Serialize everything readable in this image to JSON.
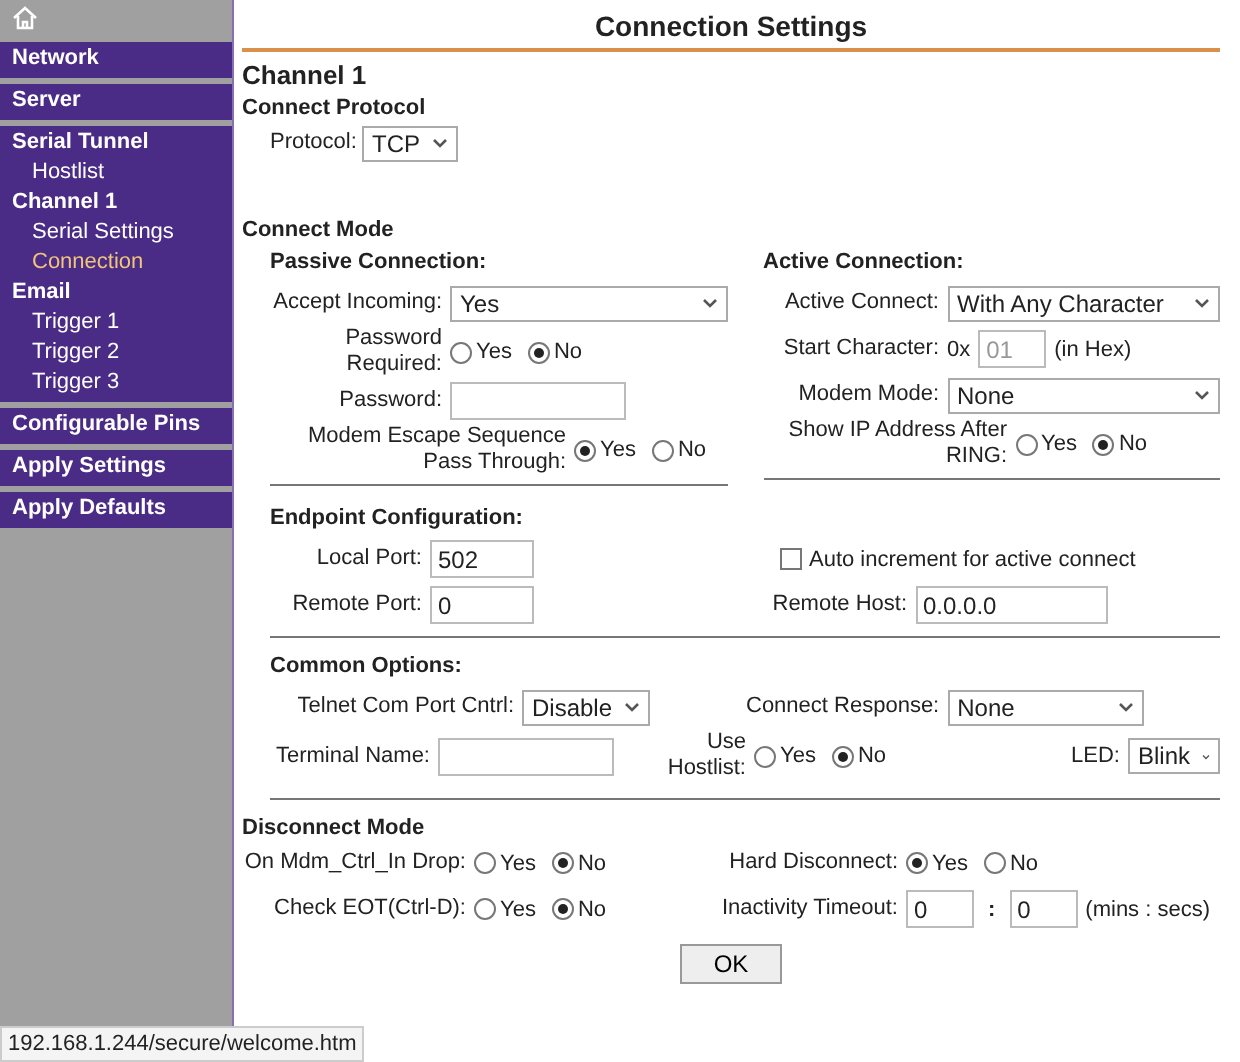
{
  "sidebar": {
    "groups": [
      {
        "items": [
          {
            "label": "Network",
            "kind": "head",
            "selected": false
          }
        ]
      },
      {
        "items": [
          {
            "label": "Server",
            "kind": "head",
            "selected": false
          }
        ]
      },
      {
        "items": [
          {
            "label": "Serial Tunnel",
            "kind": "head",
            "selected": false
          },
          {
            "label": "Hostlist",
            "kind": "sub",
            "selected": false
          },
          {
            "label": "Channel 1",
            "kind": "head",
            "selected": false
          },
          {
            "label": "Serial Settings",
            "kind": "sub",
            "selected": false
          },
          {
            "label": "Connection",
            "kind": "sub",
            "selected": true
          },
          {
            "label": "Email",
            "kind": "head",
            "selected": false
          },
          {
            "label": "Trigger 1",
            "kind": "sub",
            "selected": false
          },
          {
            "label": "Trigger 2",
            "kind": "sub",
            "selected": false
          },
          {
            "label": "Trigger 3",
            "kind": "sub",
            "selected": false
          }
        ]
      },
      {
        "items": [
          {
            "label": "Configurable Pins",
            "kind": "head",
            "selected": false
          }
        ]
      },
      {
        "items": [
          {
            "label": "Apply Settings",
            "kind": "head",
            "selected": false
          }
        ]
      },
      {
        "items": [
          {
            "label": "Apply Defaults",
            "kind": "head",
            "selected": false
          }
        ]
      }
    ]
  },
  "title": "Connection Settings",
  "channel": "Channel 1",
  "protocol": {
    "heading": "Connect Protocol",
    "field": {
      "kind": "select",
      "label": "Protocol:",
      "value": "TCP"
    }
  },
  "connect_mode": {
    "heading": "Connect Mode",
    "columns": [
      {
        "heading": "Passive Connection:",
        "fields": [
          {
            "kind": "select",
            "label": "Accept Incoming:",
            "value": "Yes"
          },
          {
            "kind": "radio",
            "label": "Password Required:",
            "options": [
              {
                "label": "Yes",
                "selected": false
              },
              {
                "label": "No",
                "selected": true
              }
            ]
          },
          {
            "kind": "text",
            "label": "Password:"
          },
          {
            "kind": "wide_radio",
            "label": "Modem Escape Sequence Pass Through:",
            "options": [
              {
                "label": "Yes",
                "selected": true
              },
              {
                "label": "No",
                "selected": false
              }
            ]
          }
        ]
      },
      {
        "heading": "Active Connection:",
        "fields": [
          {
            "kind": "select",
            "label": "Active Connect:",
            "value": "With Any Character"
          },
          {
            "kind": "text",
            "label": "Start Character:",
            "prefix": "0x",
            "value": "01",
            "suffix": "(in Hex)",
            "disabled": true
          },
          {
            "kind": "select",
            "label": "Modem Mode:",
            "value": "None"
          },
          {
            "kind": "wide_radio",
            "label": "Show IP Address After RING:",
            "options": [
              {
                "label": "Yes",
                "selected": false
              },
              {
                "label": "No",
                "selected": true
              }
            ]
          }
        ]
      }
    ]
  },
  "endpoint": {
    "heading": "Endpoint Configuration:",
    "columns": [
      {
        "fields": [
          {
            "kind": "text",
            "label": "Local Port:",
            "value": "502"
          },
          {
            "kind": "text",
            "label": "Remote Port:",
            "value": "0"
          }
        ]
      },
      {
        "fields": [
          {
            "kind": "checkbox",
            "label": "Auto increment for active connect",
            "checked": false
          },
          {
            "kind": "text",
            "label": "Remote Host:",
            "value": "0.0.0.0"
          }
        ]
      }
    ]
  },
  "common_options": {
    "heading": "Common Options:",
    "rows": [
      [
        {
          "kind": "select",
          "label": "Telnet Com Port Cntrl:",
          "value": "Disable"
        },
        {
          "kind": "select",
          "label": "Connect Response:",
          "value": "None"
        }
      ],
      [
        {
          "kind": "text",
          "label": "Terminal Name:"
        },
        {
          "kind": "radio",
          "label": "Use Hostlist:",
          "options": [
            {
              "label": "Yes",
              "selected": false
            },
            {
              "label": "No",
              "selected": true
            }
          ]
        },
        {
          "kind": "select",
          "label": "LED:",
          "value": "Blink"
        }
      ]
    ]
  },
  "disconnect_mode": {
    "heading": "Disconnect Mode",
    "columns": [
      {
        "fields": [
          {
            "kind": "radio",
            "label": "On Mdm_Ctrl_In Drop:",
            "options": [
              {
                "label": "Yes",
                "selected": false
              },
              {
                "label": "No",
                "selected": true
              }
            ]
          },
          {
            "kind": "radio",
            "label": "Check EOT(Ctrl-D):",
            "options": [
              {
                "label": "Yes",
                "selected": false
              },
              {
                "label": "No",
                "selected": true
              }
            ]
          }
        ]
      },
      {
        "fields": [
          {
            "kind": "radio",
            "label": "Hard Disconnect:",
            "options": [
              {
                "label": "Yes",
                "selected": true
              },
              {
                "label": "No",
                "selected": false
              }
            ]
          },
          {
            "kind": "time",
            "label": "Inactivity Timeout:",
            "values": [
              "0",
              "0"
            ],
            "separator": ":",
            "suffix": "(mins : secs)"
          }
        ]
      }
    ]
  },
  "ok_button": "OK",
  "status_bar": {
    "url": "192.168.1.244/secure/welcome.htm"
  }
}
